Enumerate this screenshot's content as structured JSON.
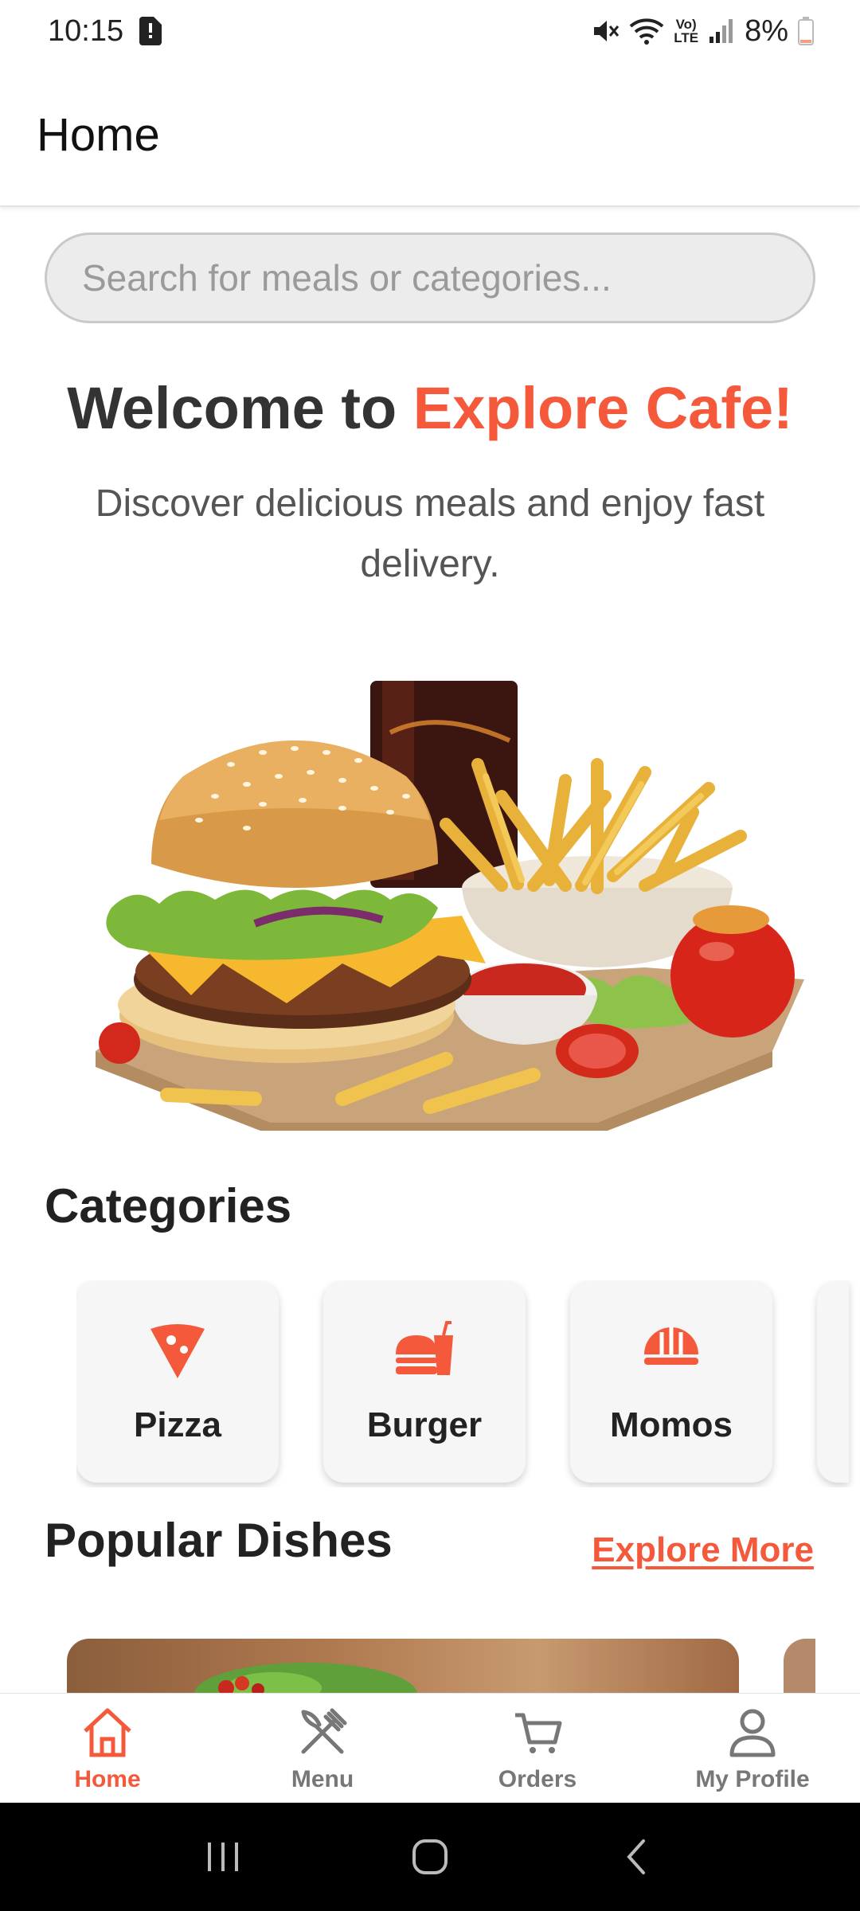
{
  "status_bar": {
    "time": "10:15",
    "lte": "Vo)\nLTE",
    "battery": "8%"
  },
  "app_bar": {
    "title": "Home"
  },
  "search": {
    "placeholder": "Search for meals or categories..."
  },
  "welcome": {
    "prefix": "Welcome to ",
    "brand": "Explore Cafe!",
    "tagline": "Discover delicious meals and enjoy fast delivery."
  },
  "categories": {
    "title": "Categories",
    "items": [
      {
        "label": "Pizza",
        "icon": "pizza-slice-icon"
      },
      {
        "label": "Burger",
        "icon": "burger-drink-icon"
      },
      {
        "label": "Momos",
        "icon": "momo-icon"
      }
    ]
  },
  "popular": {
    "title": "Popular Dishes",
    "explore_more": "Explore More"
  },
  "bottom_nav": {
    "items": [
      {
        "label": "Home",
        "icon": "home-icon",
        "active": true
      },
      {
        "label": "Menu",
        "icon": "utensils-icon",
        "active": false
      },
      {
        "label": "Orders",
        "icon": "cart-icon",
        "active": false
      },
      {
        "label": "My Profile",
        "icon": "profile-icon",
        "active": false
      }
    ]
  },
  "colors": {
    "accent": "#f4593b",
    "text_dark": "#222222",
    "nav_inactive": "#777777"
  }
}
